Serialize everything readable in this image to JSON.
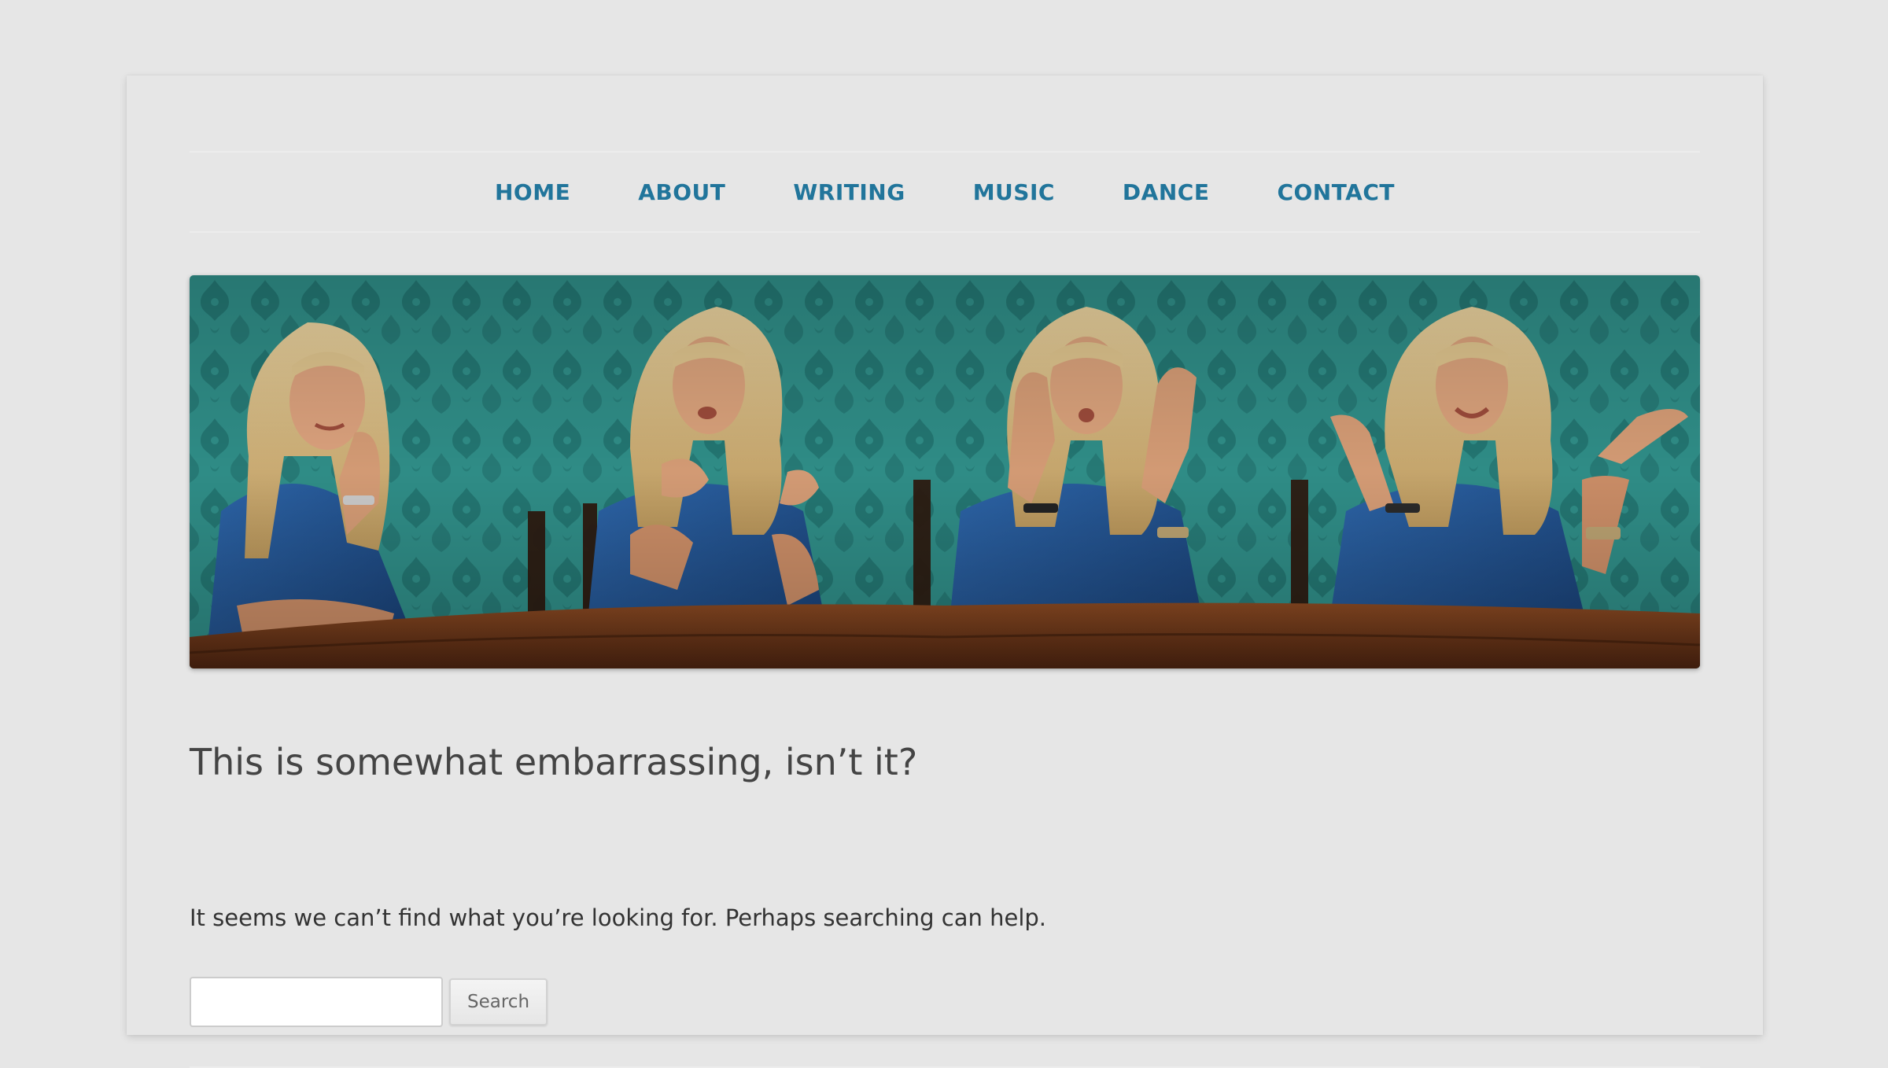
{
  "nav": {
    "items": [
      {
        "label": "HOME"
      },
      {
        "label": "ABOUT"
      },
      {
        "label": "WRITING"
      },
      {
        "label": "MUSIC"
      },
      {
        "label": "DANCE"
      },
      {
        "label": "CONTACT"
      }
    ]
  },
  "header_image": {
    "alt": "Header banner: four portraits of a smiling blonde woman in a blue shirt seated at a wooden table against a teal damask wallpaper"
  },
  "not_found": {
    "title": "This is somewhat embarrassing, isn’t it?",
    "message": "It seems we can’t find what you’re looking for. Perhaps searching can help."
  },
  "search": {
    "value": "",
    "button_label": "Search"
  },
  "colors": {
    "page_background": "#e6e6e6",
    "nav_link": "#21759b",
    "title_text": "#444444",
    "body_text": "#333333",
    "wallpaper_teal": "#2e8b84"
  }
}
